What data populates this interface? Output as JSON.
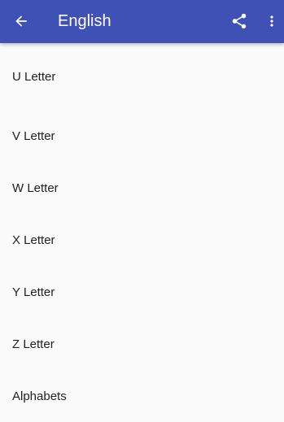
{
  "app_bar": {
    "title": "English",
    "background": "#3f51b5",
    "icons": {
      "back": "arrow-back-icon",
      "share": "share-icon",
      "overflow": "more-vert-icon"
    }
  },
  "list": {
    "items": [
      {
        "label": "U Letter"
      },
      {
        "label": "V Letter"
      },
      {
        "label": "W Letter"
      },
      {
        "label": "X Letter"
      },
      {
        "label": "Y Letter"
      },
      {
        "label": "Z Letter"
      },
      {
        "label": "Alphabets"
      }
    ]
  }
}
